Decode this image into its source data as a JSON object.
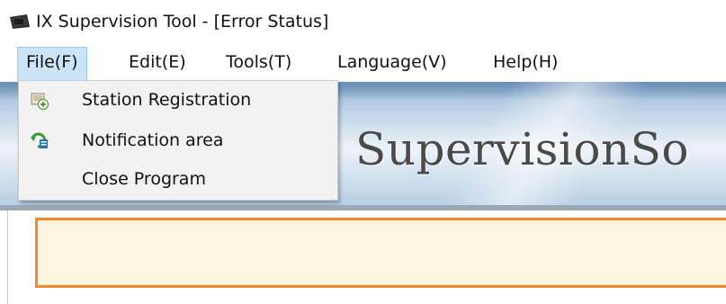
{
  "window": {
    "title": "IX Supervision Tool - [Error Status]"
  },
  "menubar": {
    "items": [
      {
        "label": "File(F)",
        "open": true
      },
      {
        "label": "Edit(E)"
      },
      {
        "label": "Tools(T)"
      },
      {
        "label": "Language(V)"
      },
      {
        "label": "Help(H)"
      }
    ]
  },
  "file_menu": {
    "items": [
      {
        "label": "Station Registration",
        "icon": "station-registration-icon"
      },
      {
        "label": "Notification area",
        "icon": "notification-area-icon"
      },
      {
        "label": "Close Program",
        "icon": ""
      }
    ]
  },
  "banner": {
    "text": "SupervisionSo"
  },
  "colors": {
    "menu_open_bg": "#cce4f7",
    "error_panel_border": "#f08a2c",
    "error_panel_bg": "#fdf5dd"
  }
}
